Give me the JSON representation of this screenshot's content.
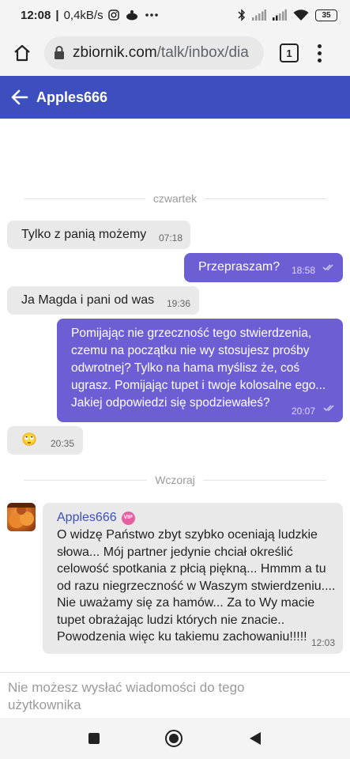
{
  "status_bar": {
    "time": "12:08",
    "speed": "0,4kB/s",
    "battery": "35",
    "icons": [
      "instagram-icon",
      "notification-icon",
      "more-dots-icon",
      "bluetooth-icon",
      "signal-icon",
      "signal-icon",
      "wifi-icon",
      "battery-icon"
    ]
  },
  "browser": {
    "domain": "zbiornik.com",
    "path": "/talk/inbox/dia",
    "tab_count": "1"
  },
  "header": {
    "title": "Apples666"
  },
  "chat": {
    "separators": [
      "czwartek",
      "Wczoraj"
    ],
    "messages": [
      {
        "dir": "in",
        "text": "Tylko z panią możemy",
        "time": "07:18"
      },
      {
        "dir": "out",
        "text": "Przepraszam?",
        "time": "18:58"
      },
      {
        "dir": "in",
        "text": "Ja Magda i pani od was",
        "time": "19:36"
      },
      {
        "dir": "out",
        "lines": [
          "Pomijając nie grzeczność tego stwierdzenia,",
          "czemu na początku nie wy stosujesz prośby",
          "odwrotnej? Tylko na hama myślisz że, coś",
          "ugrasz. Pomijając tupet i twoje kolosalne ego...",
          "Jakiej odpowiedzi się spodziewałeś?"
        ],
        "time": "20:07"
      },
      {
        "dir": "in",
        "text": "🙄",
        "time": "20:35"
      },
      {
        "dir": "in",
        "sender": "Apples666",
        "badge": "VIP",
        "lines": [
          "O widzę Państwo zbyt szybko oceniają ludzkie",
          "słowa... Mój partner jedynie chciał określić",
          "celowość spotkania z płcią piękną... Hmmm a tu",
          "od razu niegrzeczność w Waszym stwierdzeniu....",
          "Nie uważamy się za hamów... Za to Wy macie",
          "tupet obrażając ludzi których nie znacie..",
          "Powodzenia więc ku takiemu zachowaniu!!!!!"
        ],
        "time": "12:03"
      }
    ]
  },
  "input": {
    "notice_line1": "Nie możesz wysłać wiadomości do tego",
    "notice_line2": "użytkownika"
  },
  "colors": {
    "header_bg": "#3d4fbe",
    "outgoing_bubble": "#6b5fd3",
    "incoming_bubble": "#e9e9e9",
    "vip_badge": "#e85ea3"
  }
}
